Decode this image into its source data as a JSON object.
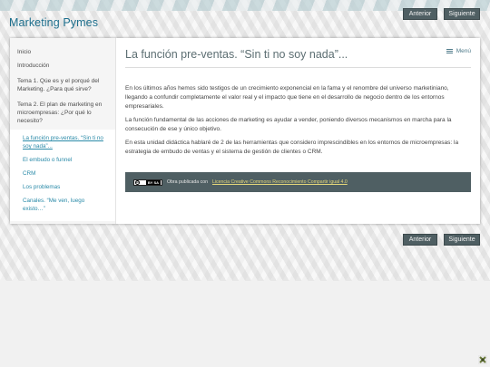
{
  "site": {
    "title": "Marketing Pymes"
  },
  "nav": {
    "prev_label": "Anterior",
    "next_label": "Siguiente"
  },
  "sidebar": {
    "items": [
      {
        "label": "Inicio"
      },
      {
        "label": "Introducción"
      },
      {
        "label": "Tema 1. Qúe es y el porqué del Marketing. ¿Para qué sirve?"
      },
      {
        "label": "Tema 2. El plan de marketing en microempresas: ¿Por qué lo necesito?"
      }
    ],
    "subitems": [
      {
        "label": "La función pre-ventas. “Sin ti no soy nada”..."
      },
      {
        "label": "El embudo o funnel"
      },
      {
        "label": "CRM"
      },
      {
        "label": "Los problemas"
      },
      {
        "label": "Canales. “Me ven, luego existo…”"
      }
    ]
  },
  "main": {
    "title": "La función pre-ventas. “Sin ti no soy nada”...",
    "menu_label": "Menú",
    "paragraphs": [
      "En los últimos años hemos sido testigos de un crecimiento exponencial en la fama y el renombre del universo marketiniano, llegando a confundir completamente el valor real y el impacto que tiene en el desarrollo de negocio dentro de los entornos empresariales.",
      "La función fundamental de las acciones de marketing es ayudar a vender, poniendo diversos mecanismos en marcha para la consecución de ese y único objetivo.",
      "En esta unidad didáctica hablaré de 2 de las herramientas que considero imprescindibles en los entornos de microempresas: la estrategia de embudo de ventas y el sistema de gestión de clientes o CRM."
    ],
    "license": {
      "badge_left": "cc",
      "badge_right": "BY SA",
      "prefix": "Obra publicada con",
      "link": "Licencia Creative Commons Reconocimiento Compartir igual 4.0"
    }
  },
  "colors": {
    "title": "#1c6e8c",
    "button_bg": "#4f5f63",
    "link": "#2a8aa8",
    "license_link": "#e3d67a"
  }
}
